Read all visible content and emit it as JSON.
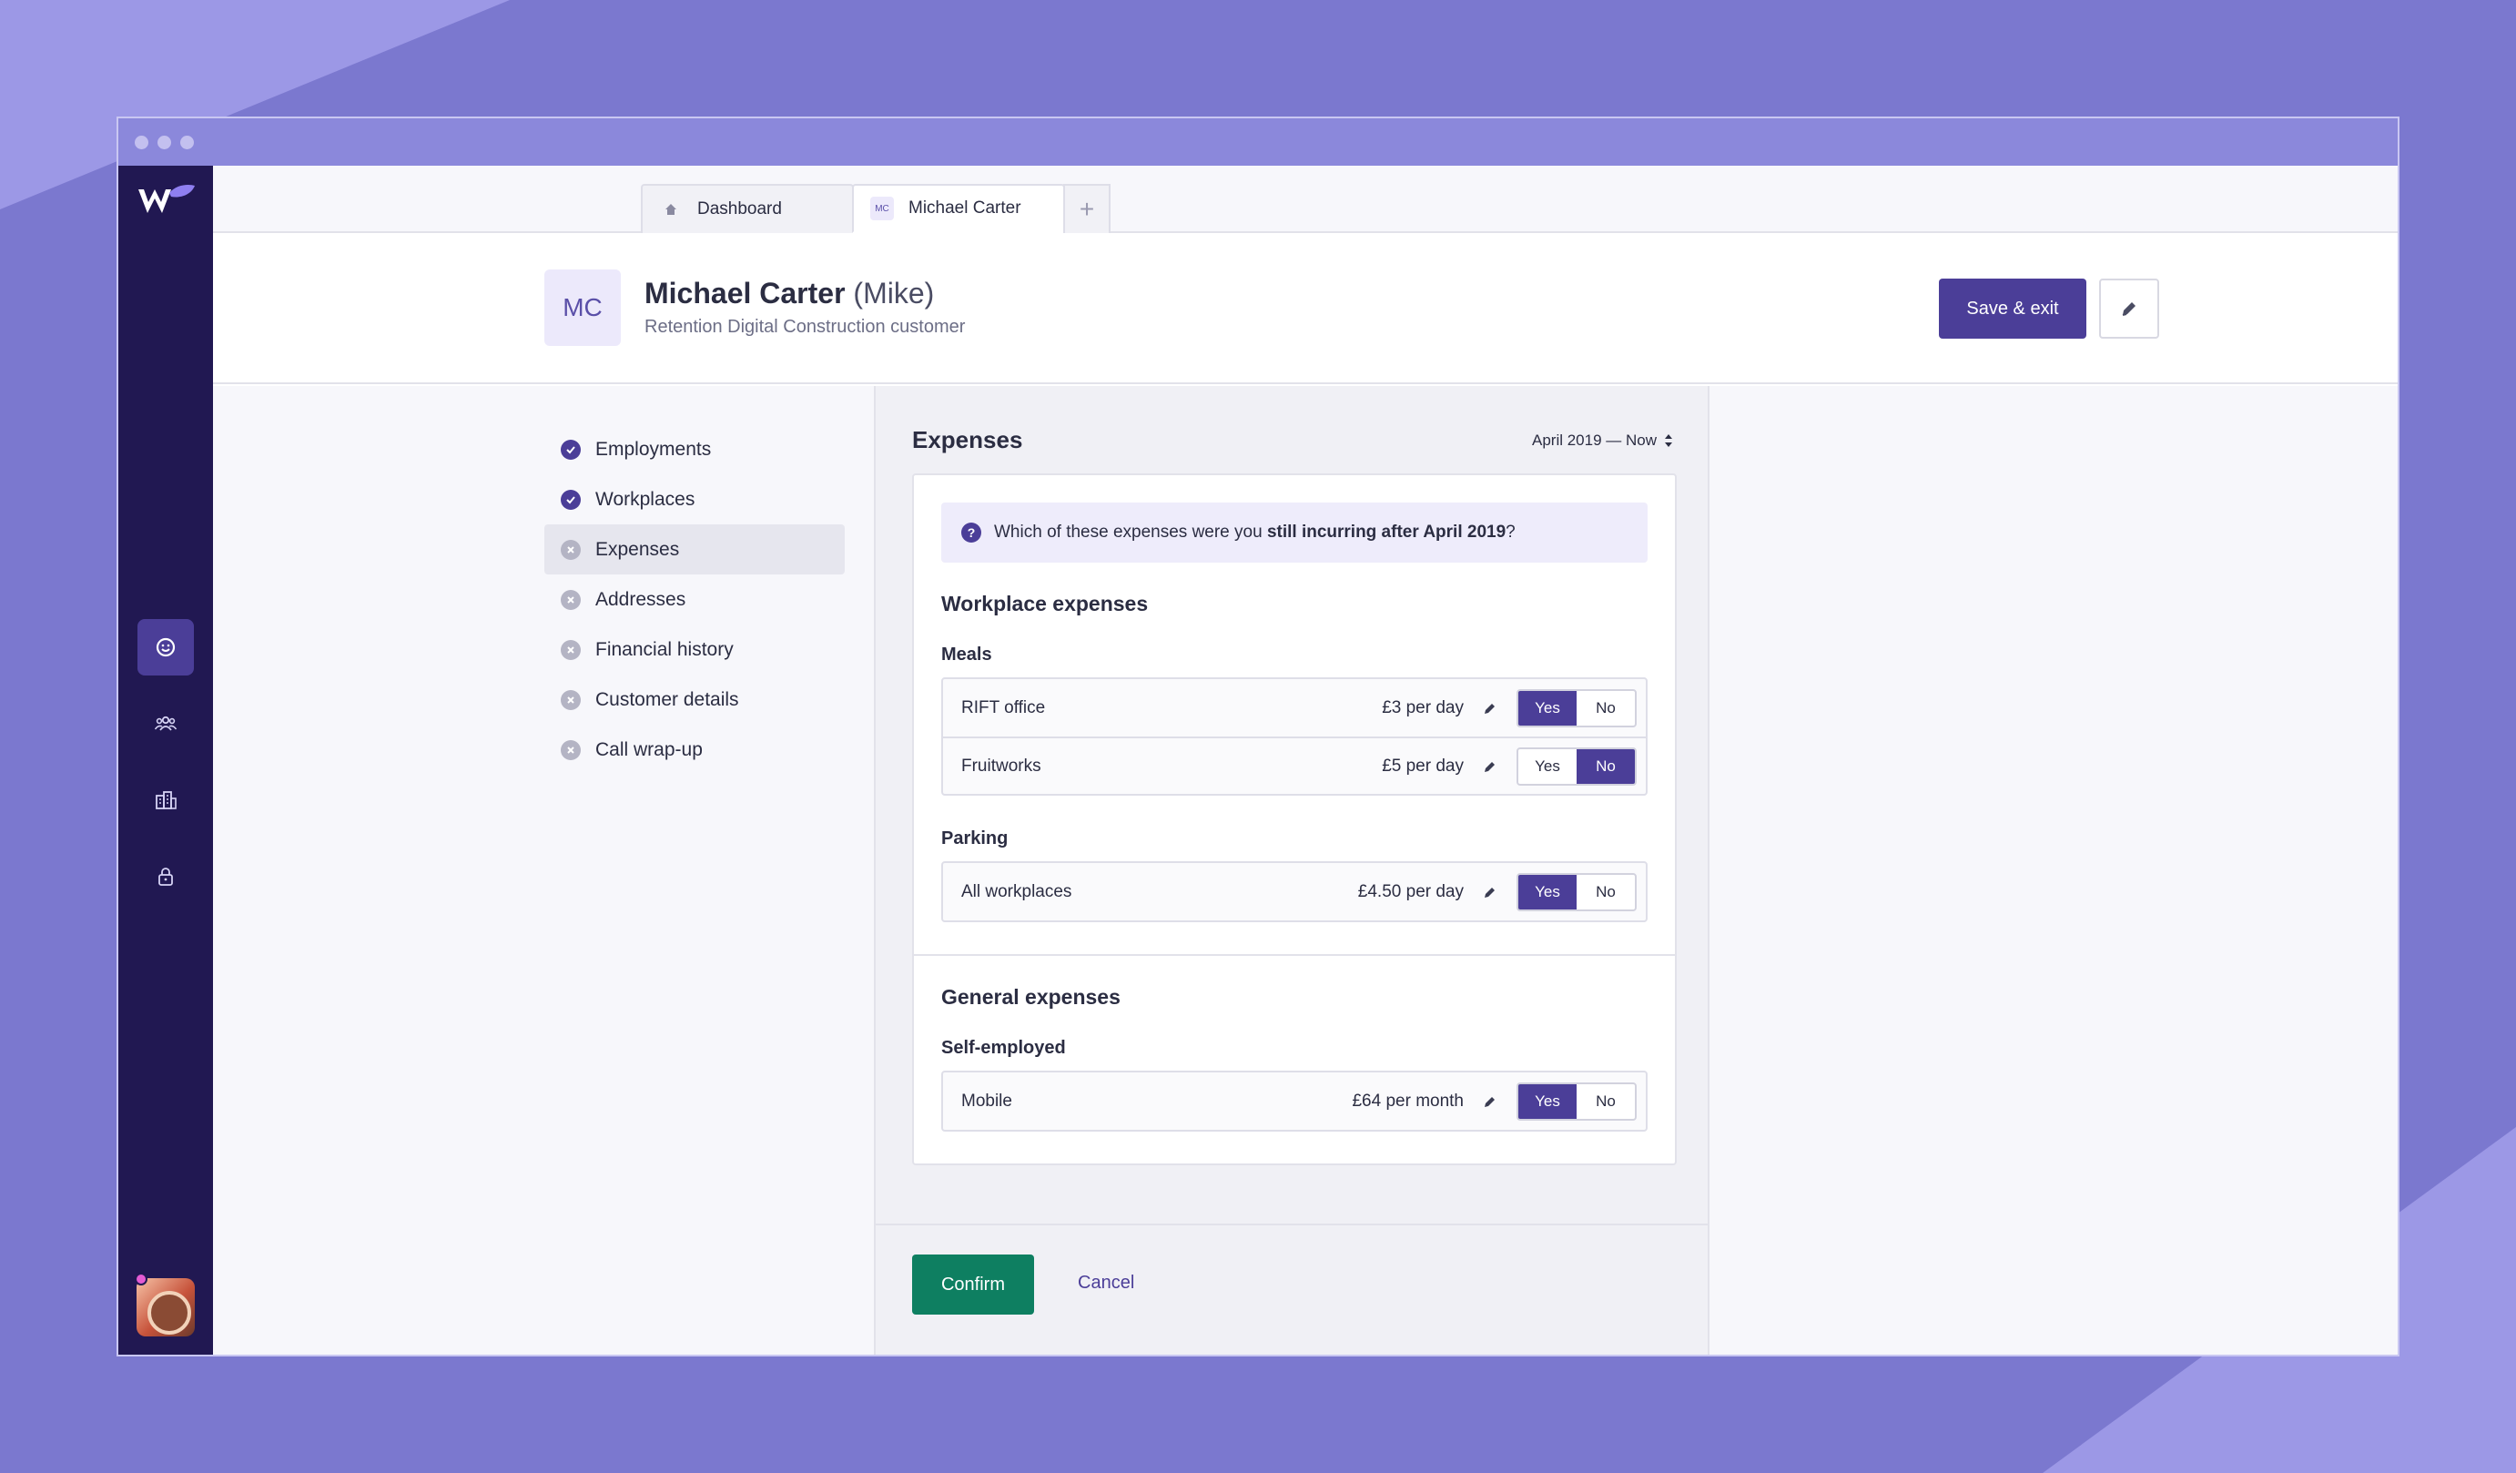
{
  "tabs": [
    {
      "label": "Dashboard",
      "icon": "home-icon"
    },
    {
      "label": "Michael Carter",
      "icon_text": "MC"
    }
  ],
  "customer": {
    "initials": "MC",
    "name": "Michael Carter",
    "nickname": "(Mike)",
    "subtitle": "Retention Digital Construction customer"
  },
  "header": {
    "save_label": "Save & exit"
  },
  "steps": [
    {
      "label": "Employments",
      "status": "done"
    },
    {
      "label": "Workplaces",
      "status": "done"
    },
    {
      "label": "Expenses",
      "status": "todo",
      "active": true
    },
    {
      "label": "Addresses",
      "status": "todo"
    },
    {
      "label": "Financial history",
      "status": "todo"
    },
    {
      "label": "Customer details",
      "status": "todo"
    },
    {
      "label": "Call wrap-up",
      "status": "todo"
    }
  ],
  "panel": {
    "title": "Expenses",
    "period": "April 2019 — Now",
    "question_prefix": "Which of these expenses were you ",
    "question_bold": "still incurring after April 2019",
    "question_suffix": "?"
  },
  "workplace_expenses": {
    "title": "Workplace expenses",
    "meals": {
      "title": "Meals",
      "rows": [
        {
          "name": "RIFT office",
          "amount": "£3 per day",
          "yes": "Yes",
          "no": "No",
          "selected": "yes"
        },
        {
          "name": "Fruitworks",
          "amount": "£5 per day",
          "yes": "Yes",
          "no": "No",
          "selected": "no"
        }
      ]
    },
    "parking": {
      "title": "Parking",
      "rows": [
        {
          "name": "All workplaces",
          "amount": "£4.50 per day",
          "yes": "Yes",
          "no": "No",
          "selected": "yes"
        }
      ]
    }
  },
  "general_expenses": {
    "title": "General expenses",
    "self_employed": {
      "title": "Self-employed",
      "rows": [
        {
          "name": "Mobile",
          "amount": "£64 per month",
          "yes": "Yes",
          "no": "No",
          "selected": "yes"
        }
      ]
    }
  },
  "footer": {
    "confirm_label": "Confirm",
    "cancel_label": "Cancel"
  },
  "colors": {
    "brand": "#4b3e98",
    "rail": "#211852",
    "confirm": "#0e7f61",
    "background": "#7b78cf"
  }
}
